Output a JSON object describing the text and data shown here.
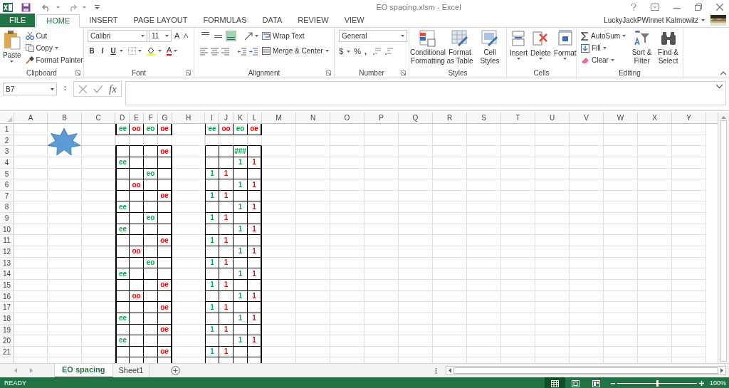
{
  "window": {
    "title": "EO spacing.xlsm - Excel"
  },
  "ribbon_tabs": [
    {
      "label": "FILE",
      "kind": "file",
      "selected": false
    },
    {
      "label": "HOME",
      "kind": "tab",
      "selected": true
    },
    {
      "label": "INSERT",
      "kind": "tab",
      "selected": false
    },
    {
      "label": "PAGE LAYOUT",
      "kind": "tab",
      "selected": false
    },
    {
      "label": "FORMULAS",
      "kind": "tab",
      "selected": false
    },
    {
      "label": "DATA",
      "kind": "tab",
      "selected": false
    },
    {
      "label": "REVIEW",
      "kind": "tab",
      "selected": false
    },
    {
      "label": "VIEW",
      "kind": "tab",
      "selected": false
    }
  ],
  "user": {
    "name": "LuckyJackPWinnet Kalmowitz"
  },
  "clipboard": {
    "label": "Clipboard",
    "paste": "Paste",
    "cut": "Cut",
    "copy": "Copy",
    "format_painter": "Format Painter"
  },
  "font": {
    "label": "Font",
    "name": "Calibri",
    "size": "11",
    "grow": "A",
    "shrink": "A",
    "bold": "B",
    "italic": "I",
    "underline": "U",
    "font_color": "A"
  },
  "alignment": {
    "label": "Alignment",
    "vertical_buttons": [
      {
        "selected": false
      },
      {
        "selected": false
      },
      {
        "selected": true
      }
    ],
    "wrap_text": "Wrap Text",
    "merge": "Merge & Center"
  },
  "number": {
    "label": "Number",
    "format": "General",
    "currency": "$",
    "percent": "%",
    "comma": ","
  },
  "styles": {
    "label": "Styles",
    "buttons": [
      "Conditional Formatting",
      "Format as Table",
      "Cell Styles"
    ]
  },
  "cells_group": {
    "label": "Cells",
    "buttons": [
      "Insert",
      "Delete",
      "Format"
    ]
  },
  "editing": {
    "label": "Editing",
    "autosum": "AutoSum",
    "fill": "Fill",
    "clear": "Clear",
    "sort": "Sort & Filter",
    "find": "Find & Select"
  },
  "formula_bar": {
    "name_box": "B7",
    "function": "fx"
  },
  "sheet": {
    "columns": [
      "A",
      "B",
      "C",
      "D",
      "E",
      "F",
      "G",
      "H",
      "I",
      "J",
      "K",
      "L",
      "M",
      "N",
      "O",
      "P",
      "Q",
      "R",
      "S",
      "T",
      "U",
      "V",
      "W",
      "X",
      "Y"
    ],
    "rows": [
      {
        "number": "1",
        "cells": [
          {},
          {},
          {},
          {
            "text": "ee",
            "color": "#00b050"
          },
          {
            "text": "oo",
            "color": "#ff0000"
          },
          {
            "text": "eo",
            "color": "#00b050"
          },
          {
            "text": "oe",
            "color": "#ff0000"
          },
          {},
          {
            "text": "ee",
            "color": "#00b050"
          },
          {
            "text": "oo",
            "color": "#ff0000"
          },
          {
            "text": "eo",
            "color": "#00b050"
          },
          {
            "text": "oe",
            "color": "#ff0000"
          }
        ]
      },
      {
        "number": "2"
      },
      {
        "number": "3",
        "cells": [
          {},
          {},
          {},
          {},
          {},
          {},
          {
            "text": "oe",
            "color": "#ff0000"
          },
          {},
          {},
          {},
          {
            "text": "###",
            "color": "#00b050"
          }
        ]
      },
      {
        "number": "4",
        "cells": [
          {},
          {},
          {},
          {
            "text": "ee",
            "color": "#00b050"
          },
          {},
          {},
          {},
          {},
          {},
          {},
          {
            "text": "1",
            "color": "#00b050"
          },
          {
            "text": "1",
            "color": "#ff0000"
          }
        ]
      },
      {
        "number": "5",
        "cells": [
          {},
          {},
          {},
          {},
          {},
          {
            "text": "eo",
            "color": "#00b050"
          },
          {},
          {},
          {
            "text": "1",
            "color": "#00b050"
          },
          {
            "text": "1",
            "color": "#ff0000"
          }
        ]
      },
      {
        "number": "6",
        "cells": [
          {},
          {},
          {},
          {},
          {
            "text": "oo",
            "color": "#ff0000"
          },
          {},
          {},
          {},
          {},
          {},
          {
            "text": "1",
            "color": "#00b050"
          },
          {
            "text": "1",
            "color": "#ff0000"
          }
        ]
      },
      {
        "number": "7",
        "cells": [
          {},
          {},
          {},
          {},
          {},
          {},
          {
            "text": "oe",
            "color": "#ff0000"
          },
          {},
          {
            "text": "1",
            "color": "#00b050"
          },
          {
            "text": "1",
            "color": "#ff0000"
          }
        ]
      },
      {
        "number": "8",
        "cells": [
          {},
          {},
          {},
          {
            "text": "ee",
            "color": "#00b050"
          },
          {},
          {},
          {},
          {},
          {},
          {},
          {
            "text": "1",
            "color": "#00b050"
          },
          {
            "text": "1",
            "color": "#ff0000"
          }
        ]
      },
      {
        "number": "9",
        "cells": [
          {},
          {},
          {},
          {},
          {},
          {
            "text": "eo",
            "color": "#00b050"
          },
          {},
          {},
          {
            "text": "1",
            "color": "#00b050"
          },
          {
            "text": "1",
            "color": "#ff0000"
          }
        ]
      },
      {
        "number": "10",
        "cells": [
          {},
          {},
          {},
          {
            "text": "ee",
            "color": "#00b050"
          },
          {},
          {},
          {},
          {},
          {},
          {},
          {
            "text": "1",
            "color": "#00b050"
          },
          {
            "text": "1",
            "color": "#ff0000"
          }
        ]
      },
      {
        "number": "11",
        "cells": [
          {},
          {},
          {},
          {},
          {},
          {},
          {
            "text": "oe",
            "color": "#ff0000"
          },
          {},
          {
            "text": "1",
            "color": "#00b050"
          },
          {
            "text": "1",
            "color": "#ff0000"
          }
        ]
      },
      {
        "number": "12",
        "cells": [
          {},
          {},
          {},
          {},
          {
            "text": "oo",
            "color": "#ff0000"
          },
          {},
          {},
          {},
          {},
          {},
          {
            "text": "1",
            "color": "#00b050"
          },
          {
            "text": "1",
            "color": "#ff0000"
          }
        ]
      },
      {
        "number": "13",
        "cells": [
          {},
          {},
          {},
          {},
          {},
          {
            "text": "eo",
            "color": "#00b050"
          },
          {},
          {},
          {
            "text": "1",
            "color": "#00b050"
          },
          {
            "text": "1",
            "color": "#ff0000"
          }
        ]
      },
      {
        "number": "14",
        "cells": [
          {},
          {},
          {},
          {
            "text": "ee",
            "color": "#00b050"
          },
          {},
          {},
          {},
          {},
          {},
          {},
          {
            "text": "1",
            "color": "#00b050"
          },
          {
            "text": "1",
            "color": "#ff0000"
          }
        ]
      },
      {
        "number": "15",
        "cells": [
          {},
          {},
          {},
          {},
          {},
          {},
          {
            "text": "oe",
            "color": "#ff0000"
          },
          {},
          {
            "text": "1",
            "color": "#00b050"
          },
          {
            "text": "1",
            "color": "#ff0000"
          }
        ]
      },
      {
        "number": "16",
        "cells": [
          {},
          {},
          {},
          {},
          {
            "text": "oo",
            "color": "#ff0000"
          },
          {},
          {},
          {},
          {},
          {},
          {
            "text": "1",
            "color": "#00b050"
          },
          {
            "text": "1",
            "color": "#ff0000"
          }
        ]
      },
      {
        "number": "17",
        "cells": [
          {},
          {},
          {},
          {},
          {},
          {},
          {
            "text": "oe",
            "color": "#ff0000"
          },
          {},
          {
            "text": "1",
            "color": "#00b050"
          },
          {
            "text": "1",
            "color": "#ff0000"
          }
        ]
      },
      {
        "number": "18",
        "cells": [
          {},
          {},
          {},
          {
            "text": "ee",
            "color": "#00b050"
          },
          {},
          {},
          {},
          {},
          {},
          {},
          {
            "text": "1",
            "color": "#00b050"
          },
          {
            "text": "1",
            "color": "#ff0000"
          }
        ]
      },
      {
        "number": "19",
        "cells": [
          {},
          {},
          {},
          {},
          {},
          {},
          {
            "text": "oe",
            "color": "#ff0000"
          },
          {},
          {
            "text": "1",
            "color": "#00b050"
          },
          {
            "text": "1",
            "color": "#ff0000"
          }
        ]
      },
      {
        "number": "20",
        "cells": [
          {},
          {},
          {},
          {
            "text": "ee",
            "color": "#00b050"
          },
          {},
          {},
          {},
          {},
          {},
          {},
          {
            "text": "1",
            "color": "#00b050"
          },
          {
            "text": "1",
            "color": "#ff0000"
          }
        ]
      },
      {
        "number": "21",
        "cells": [
          {},
          {},
          {},
          {},
          {},
          {},
          {
            "text": "oe",
            "color": "#ff0000"
          },
          {},
          {
            "text": "1",
            "color": "#00b050"
          },
          {
            "text": "1",
            "color": "#ff0000"
          }
        ]
      }
    ]
  },
  "sheet_tabs": [
    {
      "label": "EO spacing",
      "selected": true
    },
    {
      "label": "Sheet1",
      "selected": false
    }
  ],
  "status_bar": {
    "status": "READY",
    "zoom": "100%",
    "zoom_slider": {
      "level": 0.5
    },
    "views": [
      {
        "selected": true
      },
      {
        "selected": false
      },
      {
        "selected": false
      }
    ]
  }
}
